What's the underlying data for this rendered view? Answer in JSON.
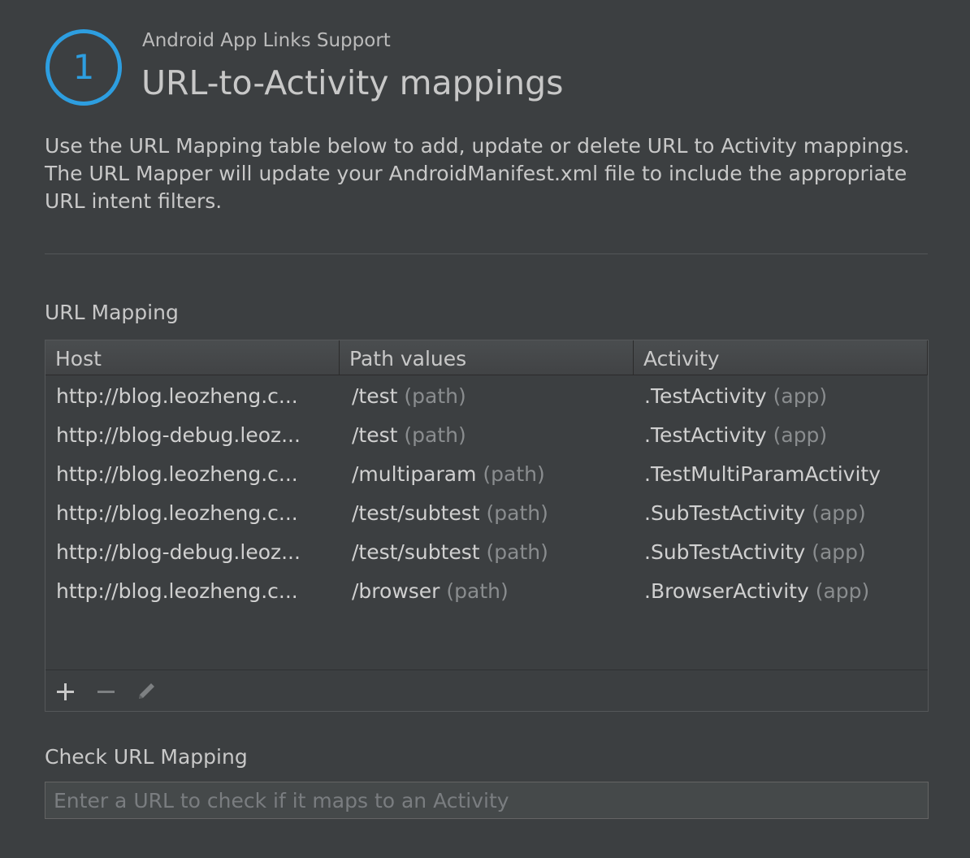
{
  "header": {
    "step_number": "1",
    "subtitle": "Android App Links Support",
    "title": "URL-to-Activity mappings",
    "description": "Use the URL Mapping table below to add, update or delete URL to Activity mappings. The URL Mapper will update your AndroidManifest.xml file to include the appropriate URL intent filters."
  },
  "url_mapping": {
    "label": "URL Mapping",
    "columns": [
      "Host",
      "Path values",
      "Activity"
    ],
    "rows": [
      {
        "host": "http://blog.leozheng.c...",
        "path": "/test",
        "path_suffix": " (path)",
        "activity": ".TestActivity",
        "activity_suffix": " (app)"
      },
      {
        "host": "http://blog-debug.leoz...",
        "path": "/test",
        "path_suffix": " (path)",
        "activity": ".TestActivity",
        "activity_suffix": " (app)"
      },
      {
        "host": "http://blog.leozheng.c...",
        "path": "/multiparam",
        "path_suffix": " (path)",
        "activity": ".TestMultiParamActivity",
        "activity_suffix": ""
      },
      {
        "host": "http://blog.leozheng.c...",
        "path": "/test/subtest",
        "path_suffix": " (path)",
        "activity": ".SubTestActivity",
        "activity_suffix": " (app)"
      },
      {
        "host": "http://blog-debug.leoz...",
        "path": "/test/subtest",
        "path_suffix": " (path)",
        "activity": ".SubTestActivity",
        "activity_suffix": " (app)"
      },
      {
        "host": "http://blog.leozheng.c...",
        "path": "/browser",
        "path_suffix": " (path)",
        "activity": ".BrowserActivity",
        "activity_suffix": " (app)"
      }
    ],
    "toolbar": {
      "add_icon": "plus-icon",
      "remove_icon": "minus-icon",
      "edit_icon": "pencil-icon"
    }
  },
  "check": {
    "label": "Check URL Mapping",
    "value": "",
    "placeholder": "Enter a URL to check if it maps to an Activity"
  },
  "colors": {
    "accent": "#2d9ee0",
    "background": "#3c3f41",
    "muted_text": "#8a8d8f"
  }
}
